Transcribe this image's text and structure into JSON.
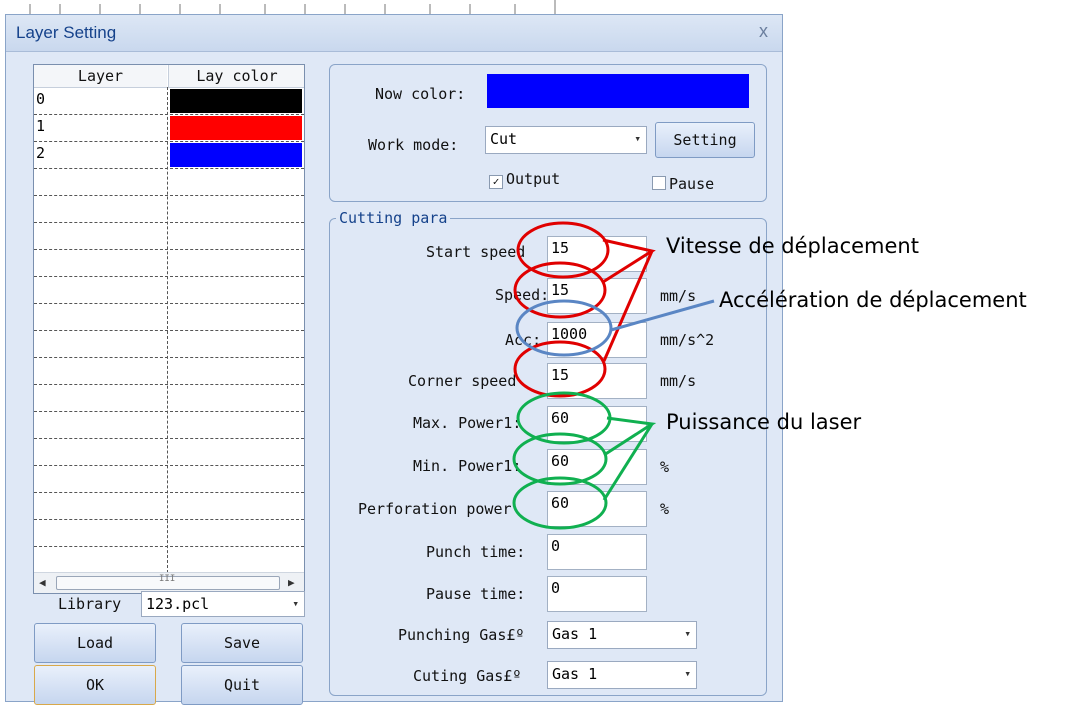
{
  "dialog": {
    "title": "Layer Setting",
    "close_glyph": "x"
  },
  "layer_list": {
    "columns": [
      "Layer",
      "Lay color"
    ],
    "rows": [
      {
        "layer": "0",
        "color": "#000000"
      },
      {
        "layer": "1",
        "color": "#ff0000"
      },
      {
        "layer": "2",
        "color": "#0000ff"
      }
    ],
    "scroll_left": "◀",
    "scroll_thumb": "III",
    "scroll_right": "▶"
  },
  "library": {
    "label": "Library",
    "value": "123.pcl"
  },
  "buttons": {
    "load": "Load",
    "save": "Save",
    "ok": "OK",
    "quit": "Quit",
    "setting": "Setting"
  },
  "layer_params": {
    "now_color_label": "Now color:",
    "now_color": "#0000ff",
    "work_mode_label": "Work mode:",
    "work_mode": "Cut",
    "output_label": "Output",
    "output_checked": true,
    "pause_label": "Pause",
    "pause_checked": false
  },
  "cutting_para": {
    "title": "Cutting para",
    "fields": {
      "start_speed": {
        "label": "Start speed",
        "value": "15",
        "unit": ""
      },
      "speed": {
        "label": "Speed:",
        "value": "15",
        "unit": "mm/s"
      },
      "acc": {
        "label": "Acc:",
        "value": "1000",
        "unit": "mm/s^2"
      },
      "corner_speed": {
        "label": "Corner speed",
        "value": "15",
        "unit": "mm/s"
      },
      "max_power": {
        "label": "Max. Power1:",
        "value": "60",
        "unit": ""
      },
      "min_power": {
        "label": "Min. Power1:",
        "value": "60",
        "unit": "%"
      },
      "perforation_power": {
        "label": "Perforation power",
        "value": "60",
        "unit": "%"
      },
      "punch_time": {
        "label": "Punch time:",
        "value": "0"
      },
      "pause_time": {
        "label": "Pause time:",
        "value": "0"
      }
    },
    "punching_gas": {
      "label": "Punching Gas£º",
      "value": "Gas 1"
    },
    "cutting_gas": {
      "label": "Cuting Gas£º",
      "value": "Gas 1"
    }
  },
  "annotations": {
    "speed": "Vitesse de déplacement",
    "acceleration": "Accélération de déplacement",
    "power": "Puissance du laser",
    "colors": {
      "speed": "#e00000",
      "acceleration": "#5a86c4",
      "power": "#10b050"
    }
  }
}
